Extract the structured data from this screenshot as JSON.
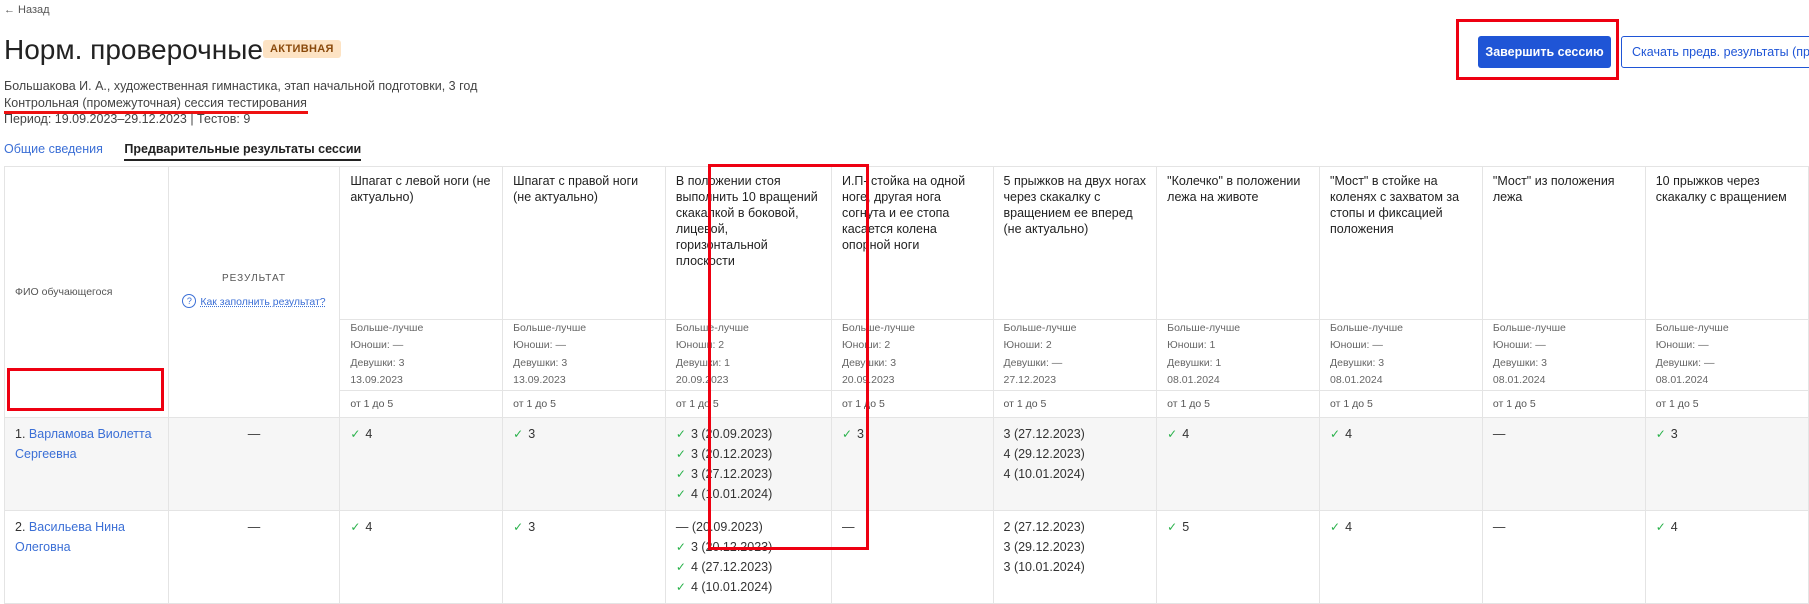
{
  "nav": {
    "back": "← Назад"
  },
  "header": {
    "title": "Норм. проверочные",
    "badge": "АКТИВНАЯ",
    "info": "Большакова И. А., художественная гимнастика, этап начальной подготовки, 3 год",
    "session_type": "Контрольная (промежуточная) сессия тестирования",
    "period": "Период: 19.09.2023–29.12.2023 | Тестов: 9"
  },
  "actions": {
    "finish": "Завершить сессию",
    "download": "Скачать предв. результаты (пр"
  },
  "tabs": [
    "Общие сведения",
    "Предварительные результаты сессии"
  ],
  "colors": {
    "accent": "#1f55d6",
    "link": "#3b6fd6",
    "highlight": "#e01",
    "check": "#2bb24c",
    "badge_bg": "#fde3c4"
  },
  "table": {
    "fio_header": "ФИО обучающегося",
    "result_header": "РЕЗУЛЬТАТ",
    "help_link": "Как заполнить результат?",
    "tests": [
      {
        "name": "Шпагат с левой ноги (не актуально)",
        "kind": "Больше-лучше",
        "boys": "Юноши: —",
        "girls": "Девушки: 3",
        "date": "13.09.2023",
        "scale": "от 1 до 5"
      },
      {
        "name": "Шпагат с правой ноги (не актуально)",
        "kind": "Больше-лучше",
        "boys": "Юноши: —",
        "girls": "Девушки: 3",
        "date": "13.09.2023",
        "scale": "от 1 до 5"
      },
      {
        "name": "В положении стоя выполнить 10 вращений скакалкой в боковой, лицевой, горизонтальной плоскости",
        "kind": "Больше-лучше",
        "boys": "Юноши: 2",
        "girls": "Девушки: 1",
        "date": "20.09.2023",
        "scale": "от 1 до 5"
      },
      {
        "name": "И.П- стойка на одной ноге, другая нога согнута и ее стопа касается колена опорной ноги",
        "kind": "Больше-лучше",
        "boys": "Юноши: 2",
        "girls": "Девушки: 3",
        "date": "20.09.2023",
        "scale": "от 1 до 5"
      },
      {
        "name": "5 прыжков на двух ногах через скакалку с вращением ее вперед (не актуально)",
        "kind": "Больше-лучше",
        "boys": "Юноши: 2",
        "girls": "Девушки: —",
        "date": "27.12.2023",
        "scale": "от 1 до 5"
      },
      {
        "name": "\"Колечко\" в положении лежа на животе",
        "kind": "Больше-лучше",
        "boys": "Юноши: 1",
        "girls": "Девушки: 1",
        "date": "08.01.2024",
        "scale": "от 1 до 5"
      },
      {
        "name": "\"Мост\" в стойке на коленях с захватом за стопы и фиксацией положения",
        "kind": "Больше-лучше",
        "boys": "Юноши: —",
        "girls": "Девушки: 3",
        "date": "08.01.2024",
        "scale": "от 1 до 5"
      },
      {
        "name": "\"Мост\" из положения лежа",
        "kind": "Больше-лучше",
        "boys": "Юноши: —",
        "girls": "Девушки: 3",
        "date": "08.01.2024",
        "scale": "от 1 до 5"
      },
      {
        "name": "10 прыжков через скакалку с вращением",
        "kind": "Больше-лучше",
        "boys": "Юноши: —",
        "girls": "Девушки: —",
        "date": "08.01.2024",
        "scale": "от 1 до 5"
      }
    ],
    "students": [
      {
        "num": "1.",
        "name": "Варламова Виолетта Сергеевна",
        "result": "—",
        "cells": [
          [
            {
              "t": "4",
              "c": true
            }
          ],
          [
            {
              "t": "3",
              "c": true
            }
          ],
          [
            {
              "t": "3 (20.09.2023)",
              "c": true
            },
            {
              "t": "3 (20.12.2023)",
              "c": true
            },
            {
              "t": "3 (27.12.2023)",
              "c": true
            },
            {
              "t": "4 (10.01.2024)",
              "c": true
            }
          ],
          [
            {
              "t": "3",
              "c": true
            }
          ],
          [
            {
              "t": "3 (27.12.2023)",
              "c": false
            },
            {
              "t": "4 (29.12.2023)",
              "c": false
            },
            {
              "t": "4 (10.01.2024)",
              "c": false
            }
          ],
          [
            {
              "t": "4",
              "c": true
            }
          ],
          [
            {
              "t": "4",
              "c": true
            }
          ],
          [
            {
              "t": "—",
              "c": false
            }
          ],
          [
            {
              "t": "3",
              "c": true
            }
          ]
        ]
      },
      {
        "num": "2.",
        "name": "Васильева Нина Олеговна",
        "result": "—",
        "cells": [
          [
            {
              "t": "4",
              "c": true
            }
          ],
          [
            {
              "t": "3",
              "c": true
            }
          ],
          [
            {
              "t": "— (20.09.2023)",
              "c": false
            },
            {
              "t": "3 (20.12.2023)",
              "c": true
            },
            {
              "t": "4 (27.12.2023)",
              "c": true
            },
            {
              "t": "4 (10.01.2024)",
              "c": true
            }
          ],
          [
            {
              "t": "—",
              "c": false
            }
          ],
          [
            {
              "t": "2 (27.12.2023)",
              "c": false
            },
            {
              "t": "3 (29.12.2023)",
              "c": false
            },
            {
              "t": "3 (10.01.2024)",
              "c": false
            }
          ],
          [
            {
              "t": "5",
              "c": true
            }
          ],
          [
            {
              "t": "4",
              "c": true
            }
          ],
          [
            {
              "t": "—",
              "c": false
            }
          ],
          [
            {
              "t": "4",
              "c": true
            }
          ]
        ]
      }
    ]
  }
}
